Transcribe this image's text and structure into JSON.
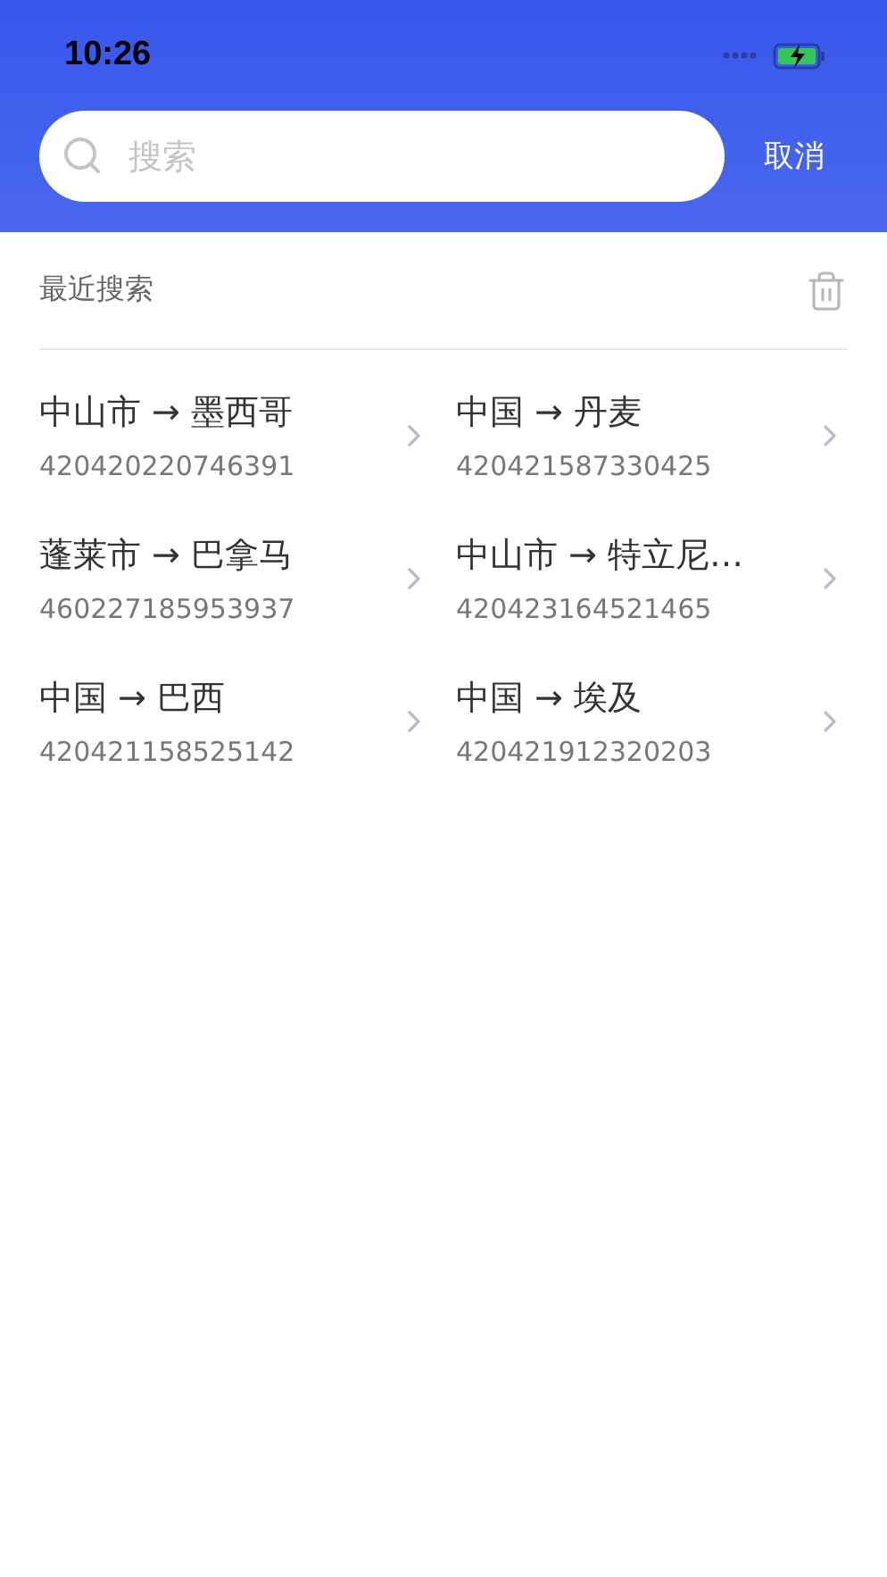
{
  "status_bar": {
    "time": "10:26"
  },
  "search": {
    "placeholder": "搜索",
    "cancel": "取消"
  },
  "recent": {
    "title": "最近搜索",
    "items": [
      {
        "route": "中山市 → 墨西哥",
        "code": "420420220746391"
      },
      {
        "route": "中国 → 丹麦",
        "code": "420421587330425"
      },
      {
        "route": "蓬莱市 → 巴拿马",
        "code": "460227185953937"
      },
      {
        "route": "中山市 → 特立尼…",
        "code": "420423164521465"
      },
      {
        "route": "中国 → 巴西",
        "code": "420421158525142"
      },
      {
        "route": "中国 → 埃及",
        "code": "420421912320203"
      }
    ]
  }
}
